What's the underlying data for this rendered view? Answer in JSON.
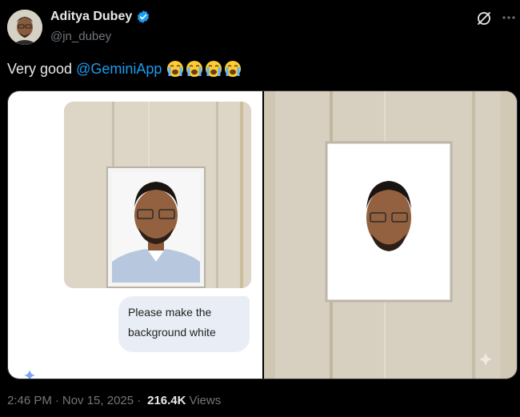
{
  "author": {
    "display_name": "Aditya Dubey",
    "handle": "@jn_dubey",
    "verified_color": "#1d9bf0"
  },
  "header_icons": [
    "grok-icon",
    "more-icon"
  ],
  "tweet": {
    "text": "Very good",
    "mention": "@GeminiApp",
    "emojis": [
      "loudly-crying-face",
      "loudly-crying-face",
      "loudly-crying-face",
      "loudly-crying-face"
    ]
  },
  "media": {
    "left": {
      "chat_prompt": "Please make the background white"
    },
    "right": {}
  },
  "footer": {
    "time": "2:46 PM",
    "separator": "·",
    "date": "Nov 15, 2025",
    "views_count": "216.4K",
    "views_label": "Views"
  },
  "colors": {
    "background": "#000000",
    "text": "#e7e9ea",
    "muted": "#71767b",
    "link": "#1d9bf0"
  }
}
